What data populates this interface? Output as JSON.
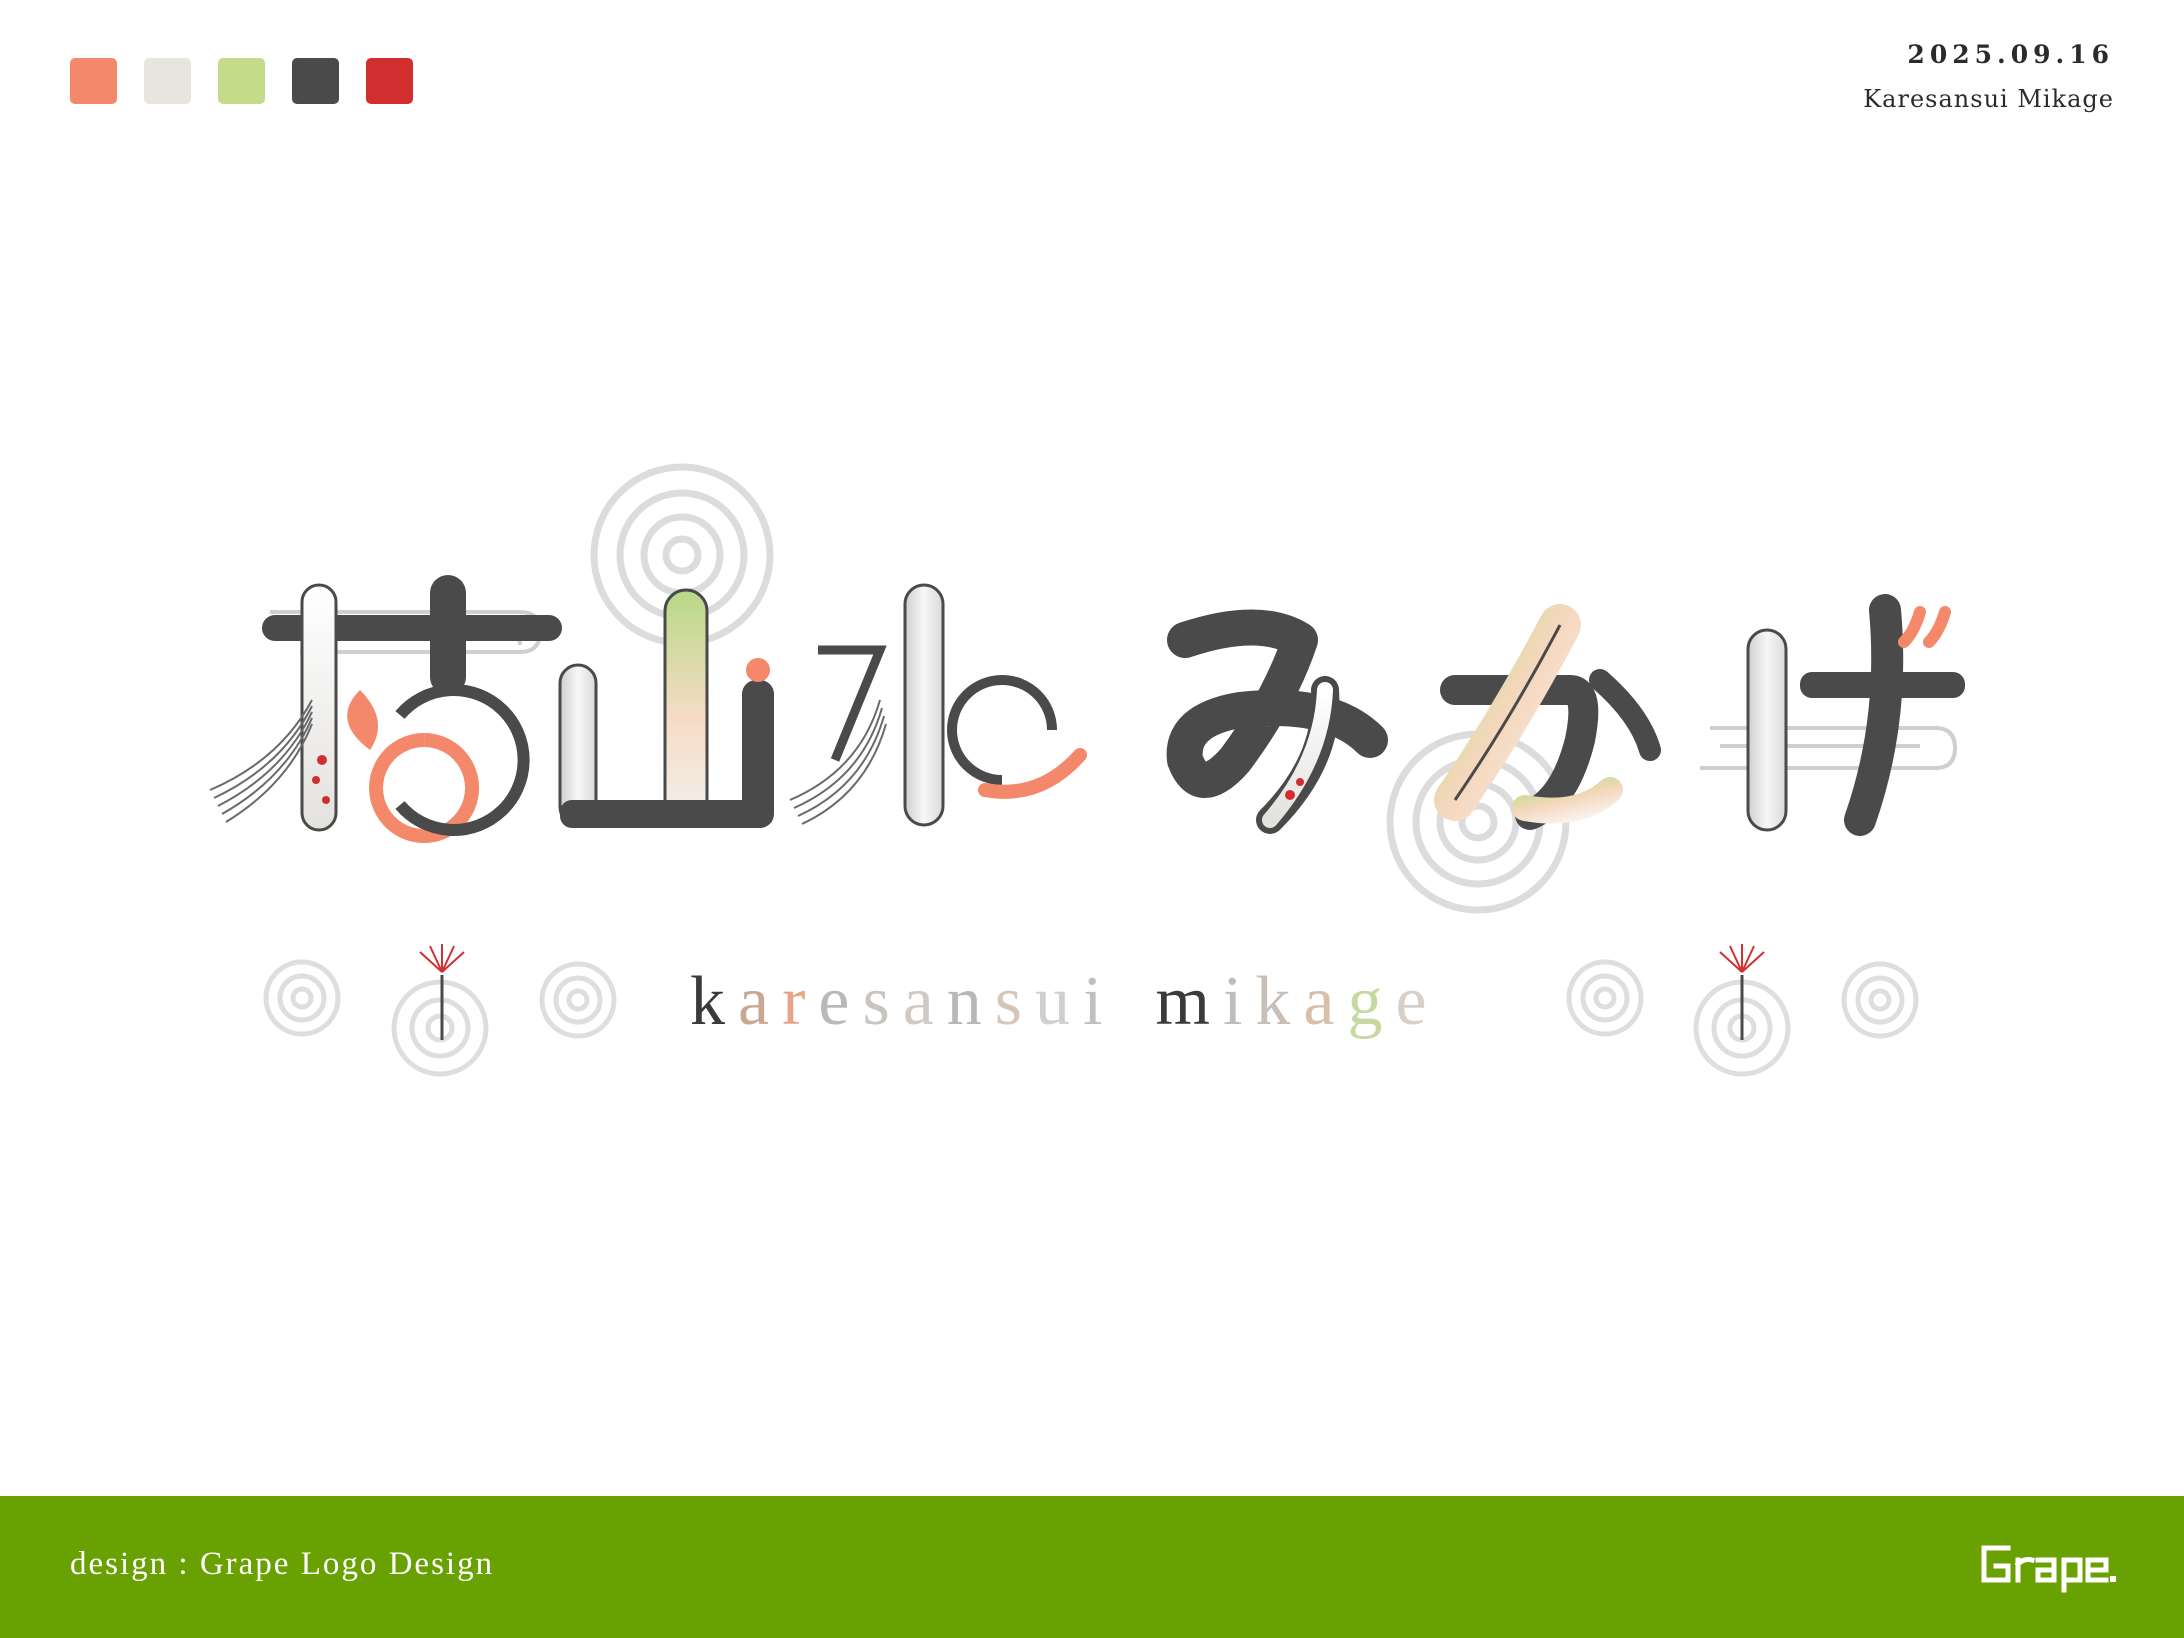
{
  "palette": {
    "swatches": [
      "#f4886a",
      "#e8e4df",
      "#c4dc8a",
      "#4a4a4a",
      "#d12f2f"
    ]
  },
  "meta": {
    "date": "2025.09.16",
    "project_name": "Karesansui Mikage"
  },
  "logo": {
    "japanese": "枯山水 みかげ",
    "subtitle": "karesansui mikage"
  },
  "footer": {
    "credit": "design : Grape Logo Design",
    "brand": "Grape."
  }
}
